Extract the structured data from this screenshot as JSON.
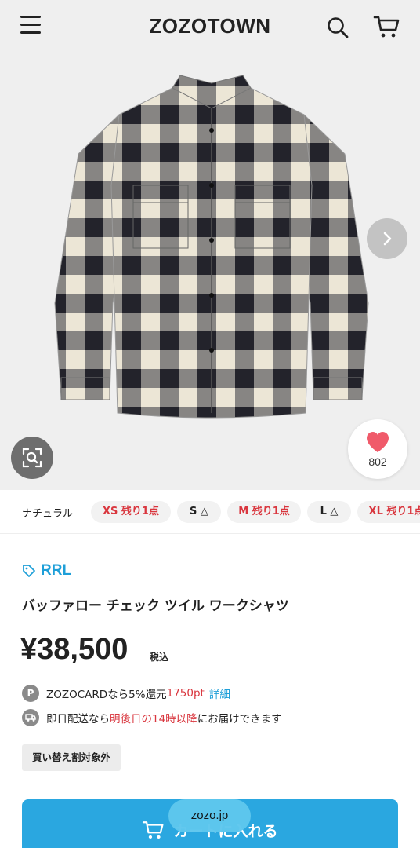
{
  "header": {
    "logo": "ZOZOTOWN",
    "menu_icon": "hamburger-menu-icon",
    "search_icon": "search-icon",
    "cart_icon": "cart-icon"
  },
  "gallery": {
    "favorite_count": "802",
    "favorite_icon": "heart-icon",
    "zoom_icon": "image-search-icon",
    "next_icon": "chevron-right-icon"
  },
  "variants": {
    "color_label": "ナチュラル",
    "sizes": [
      {
        "label": "XS 残り1点",
        "status": "low"
      },
      {
        "label": "S △",
        "status": "ok"
      },
      {
        "label": "M 残り1点",
        "status": "low"
      },
      {
        "label": "L △",
        "status": "ok"
      },
      {
        "label": "XL 残り1点",
        "status": "low"
      }
    ]
  },
  "product": {
    "brand": "RRL",
    "title": "バッファロー チェック ツイル ワークシャツ",
    "price": "¥38,500",
    "tax_label": "税込"
  },
  "points": {
    "icon_letter": "P",
    "text": "ZOZOCARDなら5%還元",
    "points_value": "1750pt",
    "details_link": "詳細"
  },
  "delivery": {
    "prefix": "即日配送なら",
    "highlight": "明後日の14時以降",
    "suffix": "にお届けできます"
  },
  "badge": "買い替え割対象外",
  "cart_button": {
    "label": "カートに入れる"
  },
  "browser": {
    "domain": "zozo.jp"
  },
  "colors": {
    "accent": "#2aa7e0",
    "brand_link": "#1e9fd8",
    "alert": "#d9363e"
  }
}
